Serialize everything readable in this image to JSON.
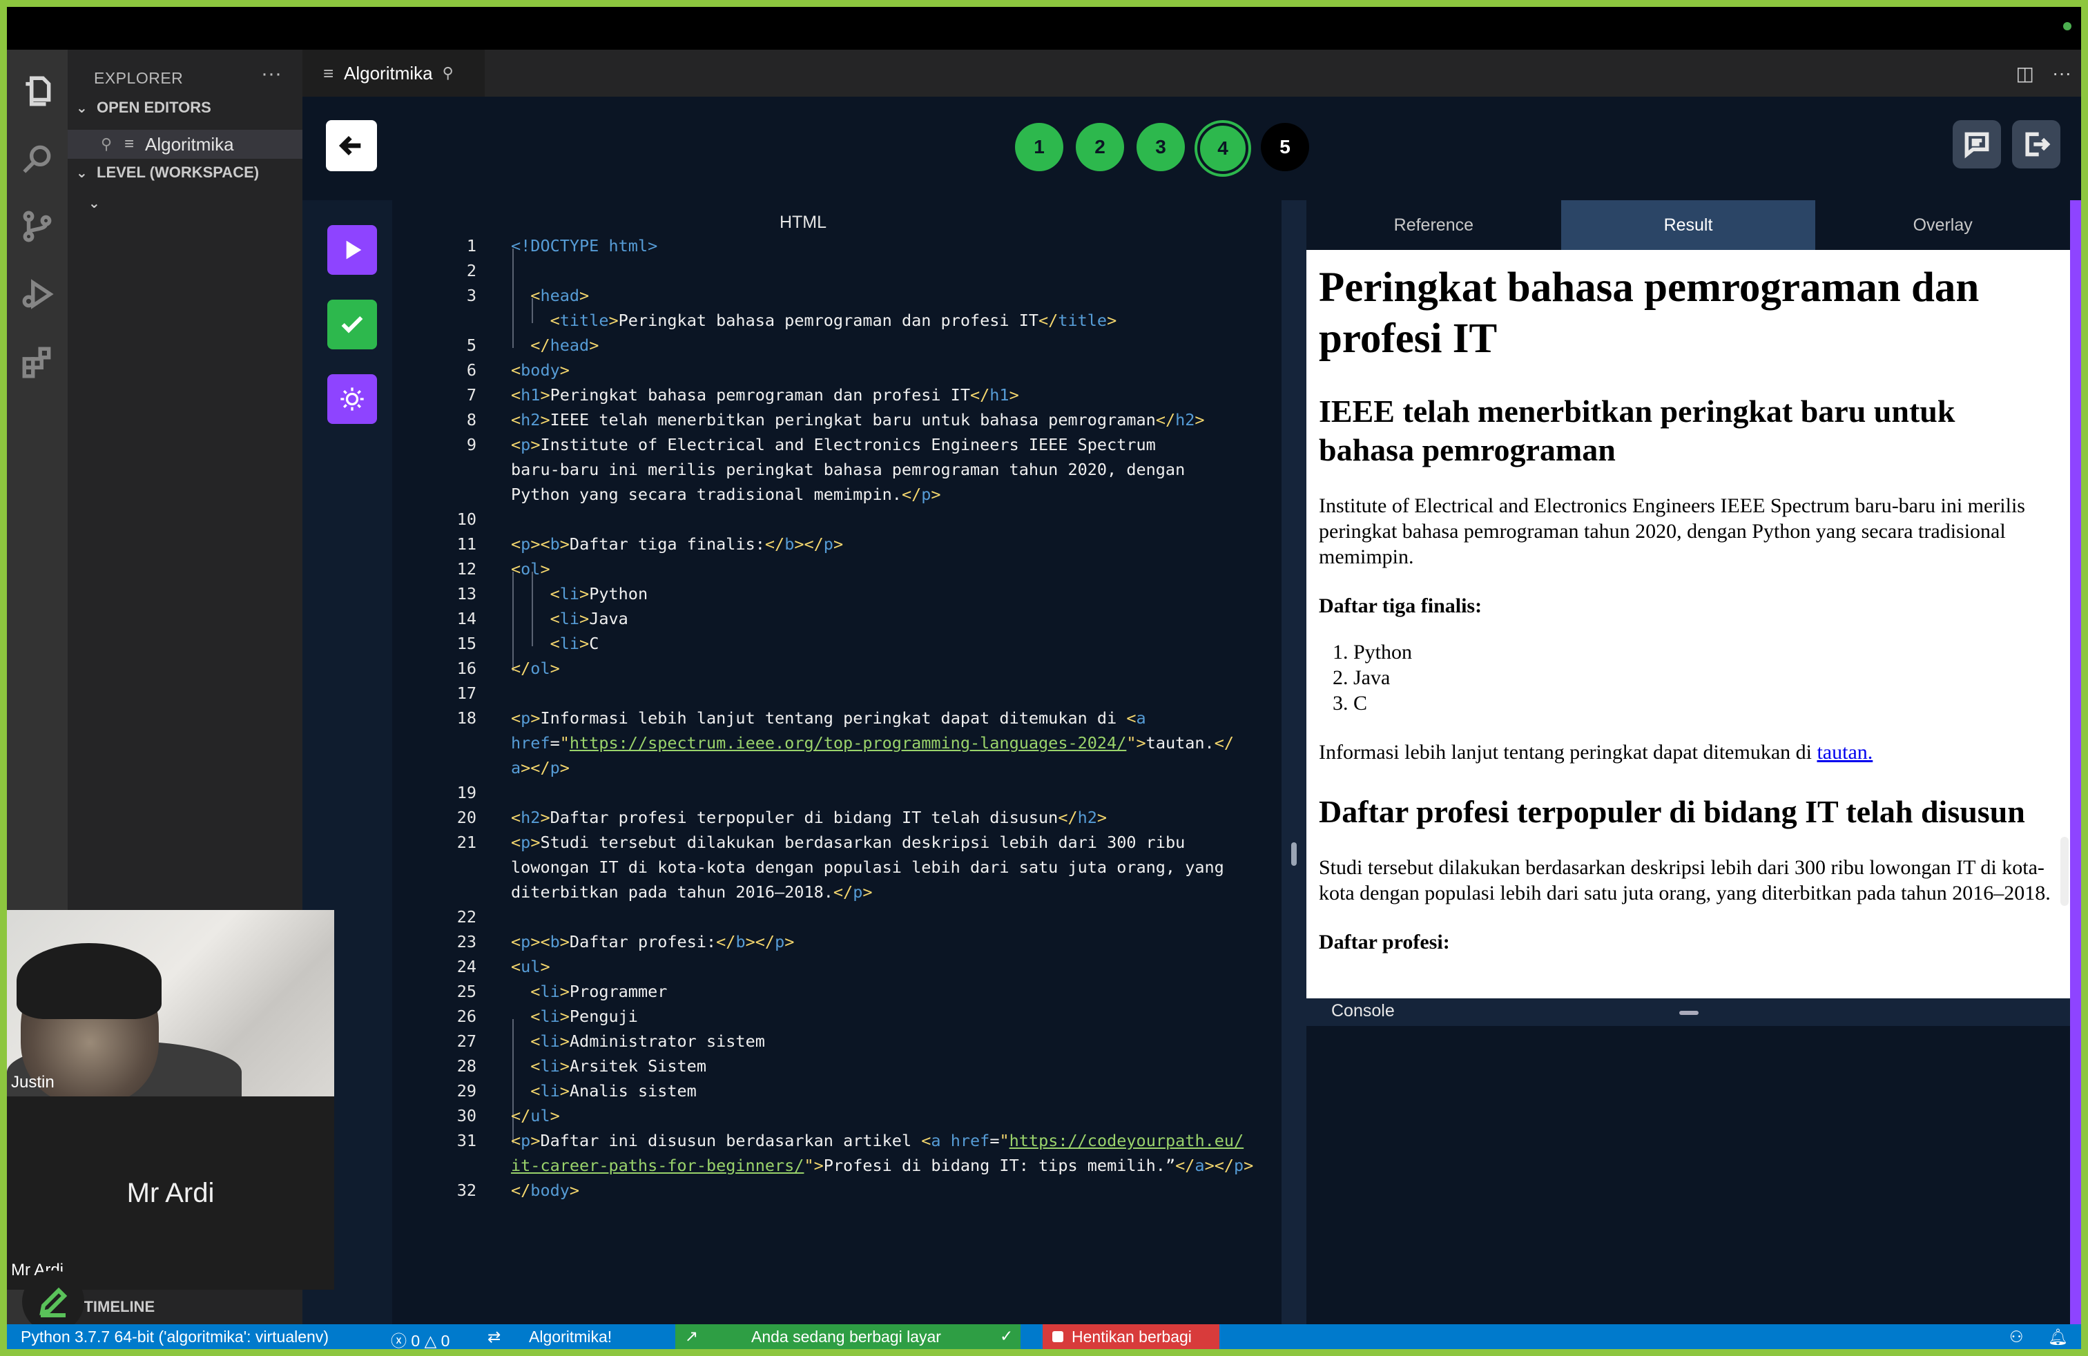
{
  "sidebar": {
    "title": "EXPLORER",
    "more": "···",
    "open_editors": "OPEN EDITORS",
    "open_file": "Algoritmika",
    "workspace": "LEVEL (WORKSPACE)",
    "timeline": "TIMELINE"
  },
  "tab": {
    "label": "Algoritmika"
  },
  "steps": [
    "1",
    "2",
    "3",
    "4",
    "5"
  ],
  "editor": {
    "title": "HTML",
    "line_numbers": [
      "1",
      "2",
      "3",
      "5",
      "6",
      "7",
      "8",
      "9",
      "10",
      "11",
      "12",
      "13",
      "14",
      "15",
      "16",
      "17",
      "18",
      "19",
      "20",
      "21",
      "22",
      "23",
      "24",
      "25",
      "26",
      "27",
      "28",
      "29",
      "30",
      "31",
      "32"
    ]
  },
  "preview": {
    "tabs": [
      "Reference",
      "Result",
      "Overlay"
    ],
    "h1": "Peringkat bahasa pemrograman dan profesi IT",
    "h2_1": "IEEE telah menerbitkan peringkat baru untuk bahasa pemrograman",
    "p1": "Institute of Electrical and Electronics Engineers IEEE Spectrum baru-baru ini merilis peringkat bahasa pemrograman tahun 2020, dengan Python yang secara tradisional memimpin.",
    "p2": "Daftar tiga finalis:",
    "list": [
      "Python",
      "Java",
      "C"
    ],
    "p3_text": "Informasi lebih lanjut tentang peringkat dapat ditemukan di ",
    "p3_link": "tautan.",
    "h2_2": "Daftar profesi terpopuler di bidang IT telah disusun",
    "p4": "Studi tersebut dilakukan berdasarkan deskripsi lebih dari 300 ribu lowongan IT di kota-kota dengan populasi lebih dari satu juta orang, yang diterbitkan pada tahun 2016–2018.",
    "p5": "Daftar profesi:",
    "console": "Console"
  },
  "video": {
    "participant1": "Justin",
    "participant2": "Mr Ardi",
    "participant2_label": "Mr Ardi"
  },
  "status": {
    "python": "Python 3.7.7 64-bit ('algoritmika': virtualenv)",
    "errors": "0",
    "warnings": "0",
    "app": "Algoritmika!",
    "sharing": "Anda sedang berbagi layar",
    "stop_sharing": "Hentikan berbagi"
  },
  "colors": {
    "accent_green": "#2db84d",
    "accent_purple": "#8e44ff",
    "status_blue": "#007acc",
    "share_green": "#2e9e44",
    "stop_red": "#d83b3b"
  }
}
